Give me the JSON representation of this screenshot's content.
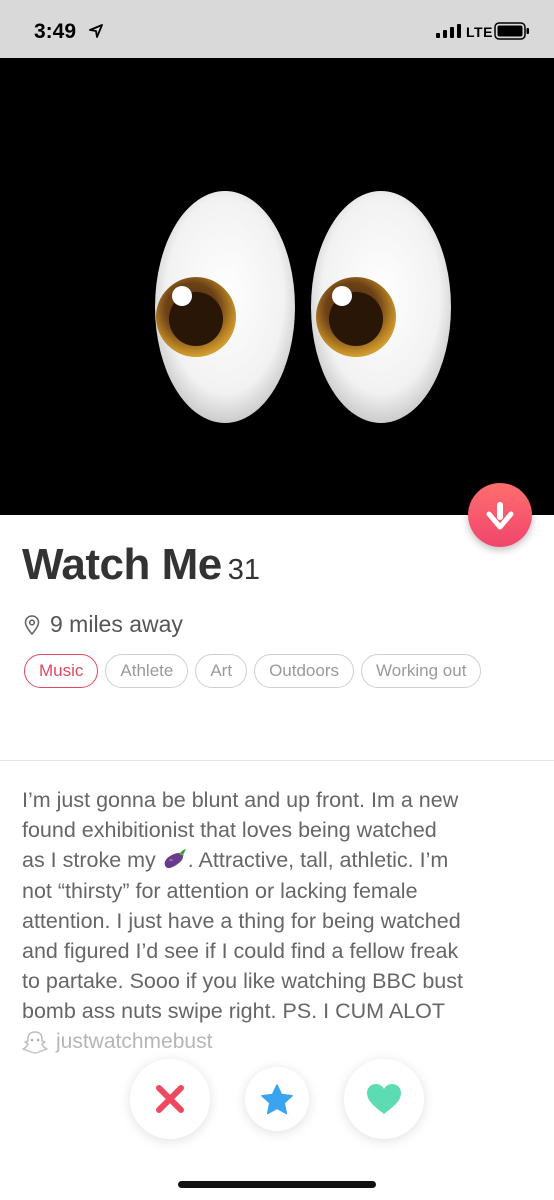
{
  "status_bar": {
    "time": "3:49",
    "network": "LTE"
  },
  "photo": {
    "description_icon": "eyes-emoji"
  },
  "profile": {
    "name": "Watch Me",
    "age": "31",
    "distance": "9 miles away",
    "interests": [
      {
        "label": "Music",
        "shared": true
      },
      {
        "label": "Athlete",
        "shared": false
      },
      {
        "label": "Art",
        "shared": false
      },
      {
        "label": "Outdoors",
        "shared": false
      },
      {
        "label": "Working out",
        "shared": false
      }
    ],
    "bio_lines": [
      "I’m just gonna be blunt and up front. Im a new",
      "found exhibitionist that loves being watched",
      "as I stroke my",
      ". Attractive, tall, athletic. I’m",
      "not “thirsty” for attention or lacking female",
      "attention. I just have a thing for being watched",
      "and figured I’d see if I could find a fellow freak",
      "to partake. Sooo if you like watching BBC bust",
      "bomb ass nuts swipe right. PS. I CUM ALOT"
    ],
    "snapchat": "justwatchmebust"
  },
  "colors": {
    "accent": "#e0495e",
    "nope": "#f0485e",
    "superlike": "#3aa4f0",
    "like": "#5ddcb4"
  }
}
